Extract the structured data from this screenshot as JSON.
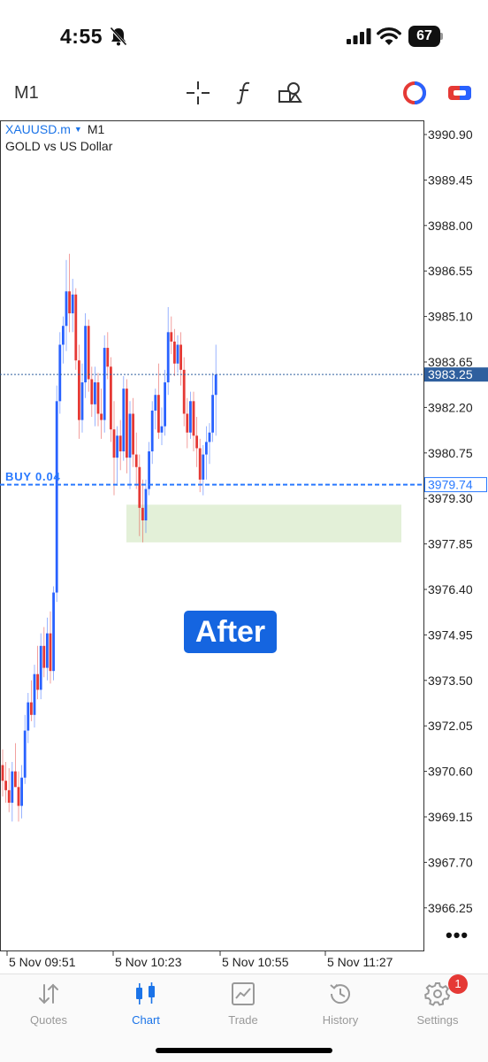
{
  "status": {
    "time": "4:55",
    "battery": "67"
  },
  "toolbar": {
    "timeframe": "M1",
    "tools": [
      "crosshair-icon",
      "function-icon",
      "objects-icon",
      "one-click-trading-icon",
      "trade-icon"
    ]
  },
  "chart": {
    "symbol": "XAUUSD.m",
    "symbol_timeframe": "M1",
    "description": "GOLD vs US Dollar",
    "price_axis": [
      "3990.90",
      "3989.45",
      "3988.00",
      "3986.55",
      "3985.10",
      "3983.65",
      "3982.20",
      "3980.75",
      "3979.30",
      "3977.85",
      "3976.40",
      "3974.95",
      "3973.50",
      "3972.05",
      "3970.60",
      "3969.15",
      "3967.70",
      "3966.25"
    ],
    "time_axis": [
      "5 Nov 09:51",
      "5 Nov 10:23",
      "5 Nov 10:55",
      "5 Nov 11:27"
    ],
    "current_price": "3983.25",
    "position_price": "3979.74",
    "position_label": "BUY 0.04",
    "overlay_text": "After",
    "colors": {
      "bull": "#2962ff",
      "bear": "#e53935",
      "zone": "#e3f0d8",
      "price_line": "#2f5f9e",
      "buy_line": "#2979ff"
    }
  },
  "chart_data": {
    "type": "candlestick",
    "ylim": [
      3965.5,
      3991.4
    ],
    "candles": [
      {
        "o": 3970.8,
        "h": 3971.3,
        "l": 3969.8,
        "c": 3970.3
      },
      {
        "o": 3970.3,
        "h": 3970.9,
        "l": 3969.6,
        "c": 3970.0
      },
      {
        "o": 3970.0,
        "h": 3970.7,
        "l": 3969.3,
        "c": 3969.6
      },
      {
        "o": 3969.6,
        "h": 3970.9,
        "l": 3969.0,
        "c": 3970.6
      },
      {
        "o": 3970.6,
        "h": 3971.5,
        "l": 3970.1,
        "c": 3970.1
      },
      {
        "o": 3970.1,
        "h": 3970.6,
        "l": 3969.0,
        "c": 3969.5
      },
      {
        "o": 3969.5,
        "h": 3970.8,
        "l": 3969.1,
        "c": 3970.4
      },
      {
        "o": 3970.4,
        "h": 3972.4,
        "l": 3970.2,
        "c": 3971.9
      },
      {
        "o": 3971.9,
        "h": 3973.1,
        "l": 3971.5,
        "c": 3972.8
      },
      {
        "o": 3972.8,
        "h": 3973.5,
        "l": 3972.2,
        "c": 3972.4
      },
      {
        "o": 3972.4,
        "h": 3974.0,
        "l": 3972.0,
        "c": 3973.7
      },
      {
        "o": 3973.7,
        "h": 3974.6,
        "l": 3972.9,
        "c": 3973.2
      },
      {
        "o": 3973.2,
        "h": 3975.0,
        "l": 3972.9,
        "c": 3974.6
      },
      {
        "o": 3974.6,
        "h": 3975.2,
        "l": 3973.6,
        "c": 3973.9
      },
      {
        "o": 3973.9,
        "h": 3975.5,
        "l": 3973.5,
        "c": 3975.0
      },
      {
        "o": 3975.0,
        "h": 3975.7,
        "l": 3973.4,
        "c": 3973.8
      },
      {
        "o": 3973.8,
        "h": 3976.5,
        "l": 3973.5,
        "c": 3976.3
      },
      {
        "o": 3976.3,
        "h": 3982.9,
        "l": 3976.0,
        "c": 3982.4
      },
      {
        "o": 3982.4,
        "h": 3984.6,
        "l": 3982.0,
        "c": 3984.2
      },
      {
        "o": 3984.2,
        "h": 3985.1,
        "l": 3983.6,
        "c": 3984.8
      },
      {
        "o": 3984.8,
        "h": 3986.9,
        "l": 3984.0,
        "c": 3985.9
      },
      {
        "o": 3985.9,
        "h": 3987.1,
        "l": 3984.6,
        "c": 3985.2
      },
      {
        "o": 3985.2,
        "h": 3986.3,
        "l": 3984.6,
        "c": 3985.8
      },
      {
        "o": 3985.8,
        "h": 3986.0,
        "l": 3983.4,
        "c": 3983.7
      },
      {
        "o": 3983.7,
        "h": 3984.2,
        "l": 3981.2,
        "c": 3981.8
      },
      {
        "o": 3981.8,
        "h": 3983.6,
        "l": 3981.4,
        "c": 3983.0
      },
      {
        "o": 3983.0,
        "h": 3985.2,
        "l": 3982.5,
        "c": 3984.8
      },
      {
        "o": 3984.8,
        "h": 3985.0,
        "l": 3982.7,
        "c": 3983.1
      },
      {
        "o": 3983.1,
        "h": 3983.5,
        "l": 3981.9,
        "c": 3982.3
      },
      {
        "o": 3982.3,
        "h": 3983.5,
        "l": 3981.6,
        "c": 3983.0
      },
      {
        "o": 3983.0,
        "h": 3983.3,
        "l": 3981.6,
        "c": 3982.0
      },
      {
        "o": 3982.0,
        "h": 3982.8,
        "l": 3981.2,
        "c": 3981.8
      },
      {
        "o": 3981.8,
        "h": 3984.5,
        "l": 3981.4,
        "c": 3984.1
      },
      {
        "o": 3984.1,
        "h": 3984.6,
        "l": 3983.1,
        "c": 3983.5
      },
      {
        "o": 3983.5,
        "h": 3983.8,
        "l": 3981.1,
        "c": 3981.5
      },
      {
        "o": 3981.5,
        "h": 3982.4,
        "l": 3979.4,
        "c": 3980.6
      },
      {
        "o": 3980.6,
        "h": 3981.6,
        "l": 3979.7,
        "c": 3981.3
      },
      {
        "o": 3981.3,
        "h": 3981.8,
        "l": 3980.2,
        "c": 3980.8
      },
      {
        "o": 3980.8,
        "h": 3983.2,
        "l": 3980.5,
        "c": 3982.8
      },
      {
        "o": 3982.8,
        "h": 3983.1,
        "l": 3980.1,
        "c": 3980.6
      },
      {
        "o": 3980.6,
        "h": 3982.4,
        "l": 3979.6,
        "c": 3982.0
      },
      {
        "o": 3982.0,
        "h": 3982.5,
        "l": 3980.3,
        "c": 3980.7
      },
      {
        "o": 3980.7,
        "h": 3981.4,
        "l": 3979.6,
        "c": 3980.3
      },
      {
        "o": 3980.3,
        "h": 3980.7,
        "l": 3978.1,
        "c": 3979.0
      },
      {
        "o": 3979.0,
        "h": 3979.9,
        "l": 3977.9,
        "c": 3978.6
      },
      {
        "o": 3978.6,
        "h": 3979.9,
        "l": 3978.2,
        "c": 3979.6
      },
      {
        "o": 3979.6,
        "h": 3981.1,
        "l": 3979.4,
        "c": 3980.8
      },
      {
        "o": 3980.8,
        "h": 3982.4,
        "l": 3980.4,
        "c": 3982.1
      },
      {
        "o": 3982.1,
        "h": 3982.8,
        "l": 3981.5,
        "c": 3982.6
      },
      {
        "o": 3982.6,
        "h": 3983.6,
        "l": 3981.2,
        "c": 3981.4
      },
      {
        "o": 3981.4,
        "h": 3982.2,
        "l": 3981.0,
        "c": 3981.6
      },
      {
        "o": 3981.6,
        "h": 3983.4,
        "l": 3981.3,
        "c": 3983.0
      },
      {
        "o": 3983.0,
        "h": 3985.4,
        "l": 3982.6,
        "c": 3984.6
      },
      {
        "o": 3984.6,
        "h": 3985.1,
        "l": 3983.9,
        "c": 3984.3
      },
      {
        "o": 3984.3,
        "h": 3984.7,
        "l": 3983.2,
        "c": 3983.6
      },
      {
        "o": 3983.6,
        "h": 3984.5,
        "l": 3983.3,
        "c": 3984.2
      },
      {
        "o": 3984.2,
        "h": 3984.6,
        "l": 3982.9,
        "c": 3983.4
      },
      {
        "o": 3983.4,
        "h": 3983.8,
        "l": 3981.6,
        "c": 3982.0
      },
      {
        "o": 3982.0,
        "h": 3982.5,
        "l": 3980.9,
        "c": 3981.4
      },
      {
        "o": 3981.4,
        "h": 3982.7,
        "l": 3981.2,
        "c": 3982.4
      },
      {
        "o": 3982.4,
        "h": 3982.7,
        "l": 3980.8,
        "c": 3981.3
      },
      {
        "o": 3981.3,
        "h": 3981.9,
        "l": 3980.3,
        "c": 3980.9
      },
      {
        "o": 3980.9,
        "h": 3981.2,
        "l": 3979.5,
        "c": 3979.9
      },
      {
        "o": 3979.9,
        "h": 3981.0,
        "l": 3979.4,
        "c": 3980.7
      },
      {
        "o": 3980.7,
        "h": 3981.6,
        "l": 3979.9,
        "c": 3981.1
      },
      {
        "o": 3981.1,
        "h": 3981.7,
        "l": 3980.4,
        "c": 3981.4
      },
      {
        "o": 3981.4,
        "h": 3983.3,
        "l": 3981.1,
        "c": 3982.6
      },
      {
        "o": 3982.6,
        "h": 3984.2,
        "l": 3981.3,
        "c": 3983.25
      }
    ]
  },
  "nav": [
    {
      "label": "Quotes",
      "icon": "quotes-icon"
    },
    {
      "label": "Chart",
      "icon": "chart-icon"
    },
    {
      "label": "Trade",
      "icon": "trade-icon"
    },
    {
      "label": "History",
      "icon": "history-icon"
    },
    {
      "label": "Settings",
      "icon": "settings-icon",
      "badge": "1"
    }
  ]
}
